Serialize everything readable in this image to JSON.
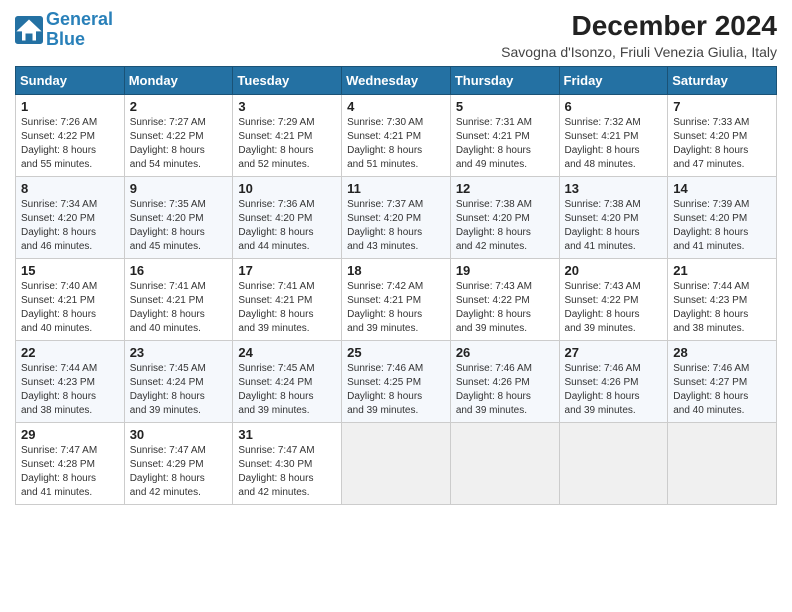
{
  "logo": {
    "line1": "General",
    "line2": "Blue"
  },
  "title": "December 2024",
  "subtitle": "Savogna d'Isonzo, Friuli Venezia Giulia, Italy",
  "weekdays": [
    "Sunday",
    "Monday",
    "Tuesday",
    "Wednesday",
    "Thursday",
    "Friday",
    "Saturday"
  ],
  "weeks": [
    [
      {
        "day": "1",
        "sunrise": "7:26 AM",
        "sunset": "4:22 PM",
        "daylight": "8 hours and 55 minutes."
      },
      {
        "day": "2",
        "sunrise": "7:27 AM",
        "sunset": "4:22 PM",
        "daylight": "8 hours and 54 minutes."
      },
      {
        "day": "3",
        "sunrise": "7:29 AM",
        "sunset": "4:21 PM",
        "daylight": "8 hours and 52 minutes."
      },
      {
        "day": "4",
        "sunrise": "7:30 AM",
        "sunset": "4:21 PM",
        "daylight": "8 hours and 51 minutes."
      },
      {
        "day": "5",
        "sunrise": "7:31 AM",
        "sunset": "4:21 PM",
        "daylight": "8 hours and 49 minutes."
      },
      {
        "day": "6",
        "sunrise": "7:32 AM",
        "sunset": "4:21 PM",
        "daylight": "8 hours and 48 minutes."
      },
      {
        "day": "7",
        "sunrise": "7:33 AM",
        "sunset": "4:20 PM",
        "daylight": "8 hours and 47 minutes."
      }
    ],
    [
      {
        "day": "8",
        "sunrise": "7:34 AM",
        "sunset": "4:20 PM",
        "daylight": "8 hours and 46 minutes."
      },
      {
        "day": "9",
        "sunrise": "7:35 AM",
        "sunset": "4:20 PM",
        "daylight": "8 hours and 45 minutes."
      },
      {
        "day": "10",
        "sunrise": "7:36 AM",
        "sunset": "4:20 PM",
        "daylight": "8 hours and 44 minutes."
      },
      {
        "day": "11",
        "sunrise": "7:37 AM",
        "sunset": "4:20 PM",
        "daylight": "8 hours and 43 minutes."
      },
      {
        "day": "12",
        "sunrise": "7:38 AM",
        "sunset": "4:20 PM",
        "daylight": "8 hours and 42 minutes."
      },
      {
        "day": "13",
        "sunrise": "7:38 AM",
        "sunset": "4:20 PM",
        "daylight": "8 hours and 41 minutes."
      },
      {
        "day": "14",
        "sunrise": "7:39 AM",
        "sunset": "4:20 PM",
        "daylight": "8 hours and 41 minutes."
      }
    ],
    [
      {
        "day": "15",
        "sunrise": "7:40 AM",
        "sunset": "4:21 PM",
        "daylight": "8 hours and 40 minutes."
      },
      {
        "day": "16",
        "sunrise": "7:41 AM",
        "sunset": "4:21 PM",
        "daylight": "8 hours and 40 minutes."
      },
      {
        "day": "17",
        "sunrise": "7:41 AM",
        "sunset": "4:21 PM",
        "daylight": "8 hours and 39 minutes."
      },
      {
        "day": "18",
        "sunrise": "7:42 AM",
        "sunset": "4:21 PM",
        "daylight": "8 hours and 39 minutes."
      },
      {
        "day": "19",
        "sunrise": "7:43 AM",
        "sunset": "4:22 PM",
        "daylight": "8 hours and 39 minutes."
      },
      {
        "day": "20",
        "sunrise": "7:43 AM",
        "sunset": "4:22 PM",
        "daylight": "8 hours and 39 minutes."
      },
      {
        "day": "21",
        "sunrise": "7:44 AM",
        "sunset": "4:23 PM",
        "daylight": "8 hours and 38 minutes."
      }
    ],
    [
      {
        "day": "22",
        "sunrise": "7:44 AM",
        "sunset": "4:23 PM",
        "daylight": "8 hours and 38 minutes."
      },
      {
        "day": "23",
        "sunrise": "7:45 AM",
        "sunset": "4:24 PM",
        "daylight": "8 hours and 39 minutes."
      },
      {
        "day": "24",
        "sunrise": "7:45 AM",
        "sunset": "4:24 PM",
        "daylight": "8 hours and 39 minutes."
      },
      {
        "day": "25",
        "sunrise": "7:46 AM",
        "sunset": "4:25 PM",
        "daylight": "8 hours and 39 minutes."
      },
      {
        "day": "26",
        "sunrise": "7:46 AM",
        "sunset": "4:26 PM",
        "daylight": "8 hours and 39 minutes."
      },
      {
        "day": "27",
        "sunrise": "7:46 AM",
        "sunset": "4:26 PM",
        "daylight": "8 hours and 39 minutes."
      },
      {
        "day": "28",
        "sunrise": "7:46 AM",
        "sunset": "4:27 PM",
        "daylight": "8 hours and 40 minutes."
      }
    ],
    [
      {
        "day": "29",
        "sunrise": "7:47 AM",
        "sunset": "4:28 PM",
        "daylight": "8 hours and 41 minutes."
      },
      {
        "day": "30",
        "sunrise": "7:47 AM",
        "sunset": "4:29 PM",
        "daylight": "8 hours and 42 minutes."
      },
      {
        "day": "31",
        "sunrise": "7:47 AM",
        "sunset": "4:30 PM",
        "daylight": "8 hours and 42 minutes."
      },
      null,
      null,
      null,
      null
    ]
  ],
  "labels": {
    "sunrise": "Sunrise:",
    "sunset": "Sunset:",
    "daylight": "Daylight:"
  }
}
